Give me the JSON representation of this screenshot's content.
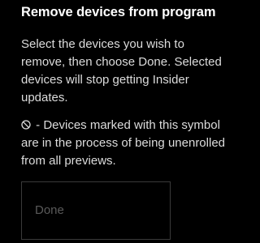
{
  "dialog": {
    "title": "Remove devices from program",
    "description": "Select the devices you wish to remove, then choose Done. Selected devices will stop getting Insider updates.",
    "note_icon": "no-entry-icon",
    "note_text": " - Devices marked with this symbol are in the process of being unenrolled from all previews.",
    "done_label": "Done",
    "done_enabled": false
  },
  "colors": {
    "background": "#000000",
    "title": "#ffffff",
    "body_text": "#dcdcdc",
    "disabled_text": "#5a5a5a",
    "disabled_border": "#3a3a3a"
  }
}
